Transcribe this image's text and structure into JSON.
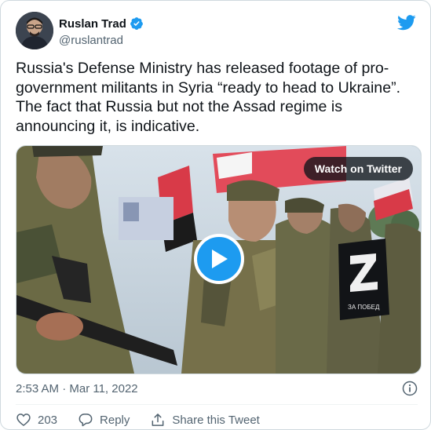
{
  "author": {
    "name": "Ruslan Trad",
    "handle": "@ruslantrad",
    "verified": true
  },
  "tweet": {
    "text": "Russia's Defense Ministry has released footage of pro-government militants in Syria “ready to head to Ukraine”. The fact that Russia but not the Assad regime is announcing it, is indicative.",
    "timestamp": "2:53 AM · Mar 11, 2022"
  },
  "media": {
    "watch_label": "Watch on Twitter",
    "sign_text": "ЗА ПОБЕД"
  },
  "actions": {
    "like_count": "203",
    "reply_label": "Reply",
    "share_label": "Share this Tweet"
  },
  "colors": {
    "accent": "#1d9bf0",
    "text": "#0f1419",
    "muted": "#536471",
    "border": "#cfd9de"
  },
  "icons": [
    "twitter-bird-icon",
    "verified-badge-icon",
    "play-icon",
    "info-icon",
    "heart-icon",
    "reply-icon",
    "share-icon"
  ]
}
